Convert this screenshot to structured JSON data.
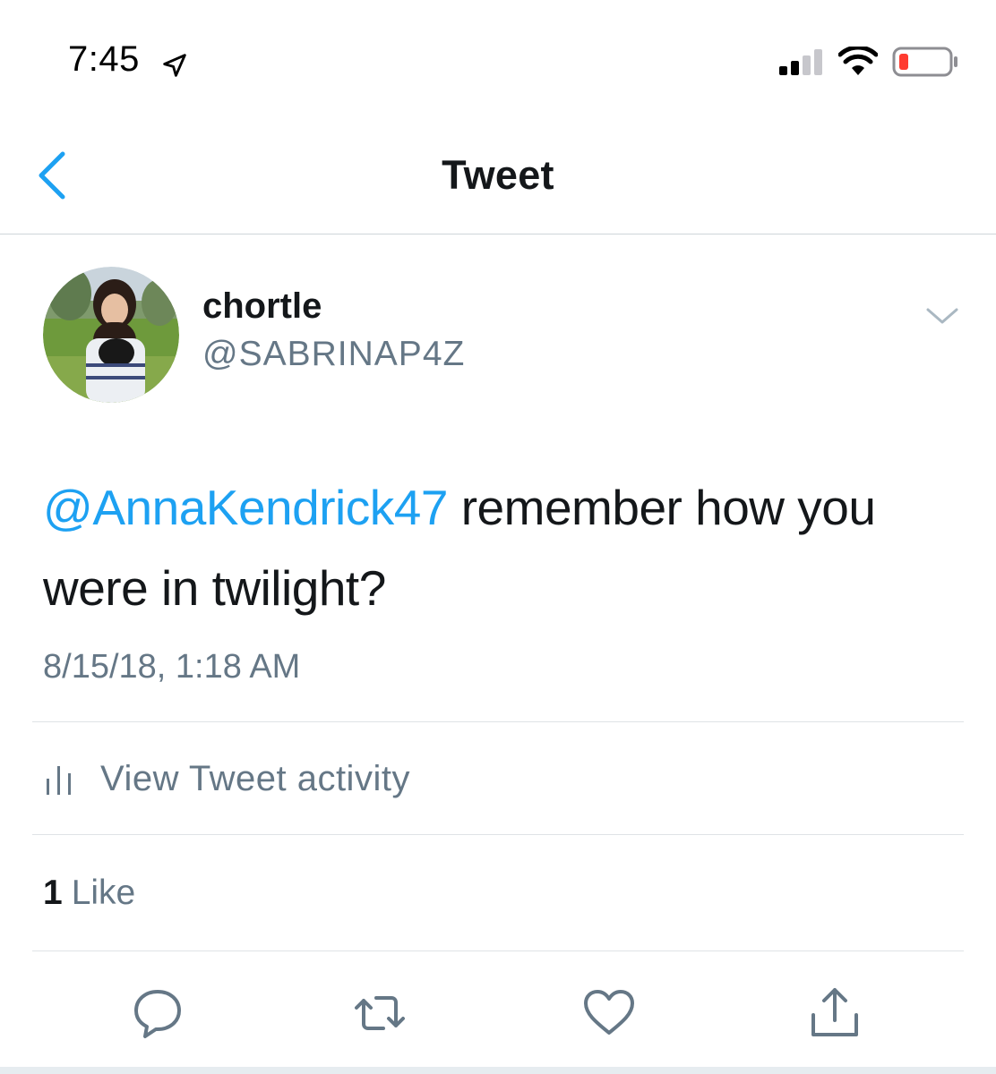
{
  "status_bar": {
    "time": "7:45"
  },
  "nav": {
    "title": "Tweet"
  },
  "tweet": {
    "display_name": "chortle",
    "handle": "@SABRINAP4Z",
    "mention": "@AnnaKendrick47",
    "text_rest": " remember how you were in twilight?",
    "timestamp": "8/15/18, 1:18 AM"
  },
  "activity": {
    "label": "View Tweet activity"
  },
  "likes": {
    "count": "1",
    "label": "Like"
  },
  "colors": {
    "accent": "#1da1f2",
    "secondary_text": "#657786",
    "primary_text": "#14171a"
  },
  "icons": [
    "location-arrow-icon",
    "cellular-signal-icon",
    "wifi-icon",
    "battery-icon",
    "back-chevron-icon",
    "caret-down-icon",
    "bar-chart-icon",
    "reply-icon",
    "retweet-icon",
    "like-heart-icon",
    "share-icon"
  ]
}
